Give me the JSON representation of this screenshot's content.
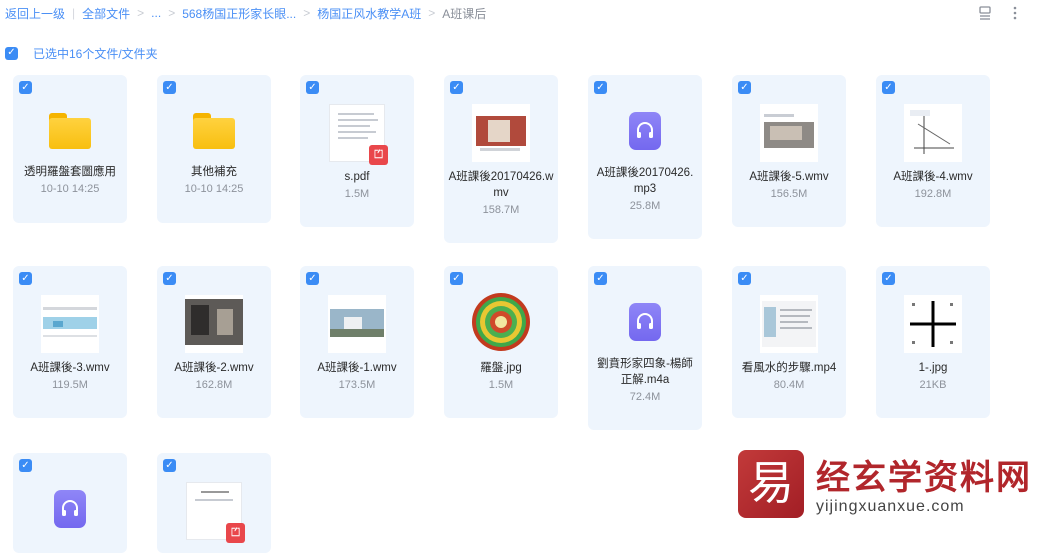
{
  "breadcrumb": {
    "back": "返回上一级",
    "all_files": "全部文件",
    "ellipsis": "...",
    "folder1": "568杨国正形家长眼...",
    "folder2": "杨国正风水教学A班",
    "current": "A班课后"
  },
  "selection": {
    "label": "已选中16个文件/文件夹"
  },
  "files": [
    {
      "name": "透明羅盤套圖應用",
      "meta": "10-10 14:25",
      "type": "folder"
    },
    {
      "name": "其他補充",
      "meta": "10-10 14:25",
      "type": "folder"
    },
    {
      "name": "s.pdf",
      "meta": "1.5M",
      "type": "pdf"
    },
    {
      "name": "A班課後20170426.wmv",
      "meta": "158.7M",
      "type": "video"
    },
    {
      "name": "A班課後20170426.mp3",
      "meta": "25.8M",
      "type": "audio"
    },
    {
      "name": "A班課後-5.wmv",
      "meta": "156.5M",
      "type": "video"
    },
    {
      "name": "A班課後-4.wmv",
      "meta": "192.8M",
      "type": "video"
    },
    {
      "name": "A班課後-3.wmv",
      "meta": "119.5M",
      "type": "video"
    },
    {
      "name": "A班課後-2.wmv",
      "meta": "162.8M",
      "type": "video"
    },
    {
      "name": "A班課後-1.wmv",
      "meta": "173.5M",
      "type": "video"
    },
    {
      "name": "羅盤.jpg",
      "meta": "1.5M",
      "type": "image"
    },
    {
      "name": "劉賁形家四象-楊師正解.m4a",
      "meta": "72.4M",
      "type": "audio"
    },
    {
      "name": "看風水的步驟.mp4",
      "meta": "80.4M",
      "type": "video"
    },
    {
      "name": "1-.jpg",
      "meta": "21KB",
      "type": "image"
    },
    {
      "name": "",
      "meta": "",
      "type": "audio"
    },
    {
      "name": "",
      "meta": "",
      "type": "pdf"
    }
  ],
  "watermark": {
    "logo_char": "易",
    "title": "经玄学资料网",
    "site": "yijingxuanxue.com"
  },
  "colors": {
    "accent": "#3b8cf5",
    "card_bg": "#eef5fd",
    "brand_red": "#b1262b"
  }
}
